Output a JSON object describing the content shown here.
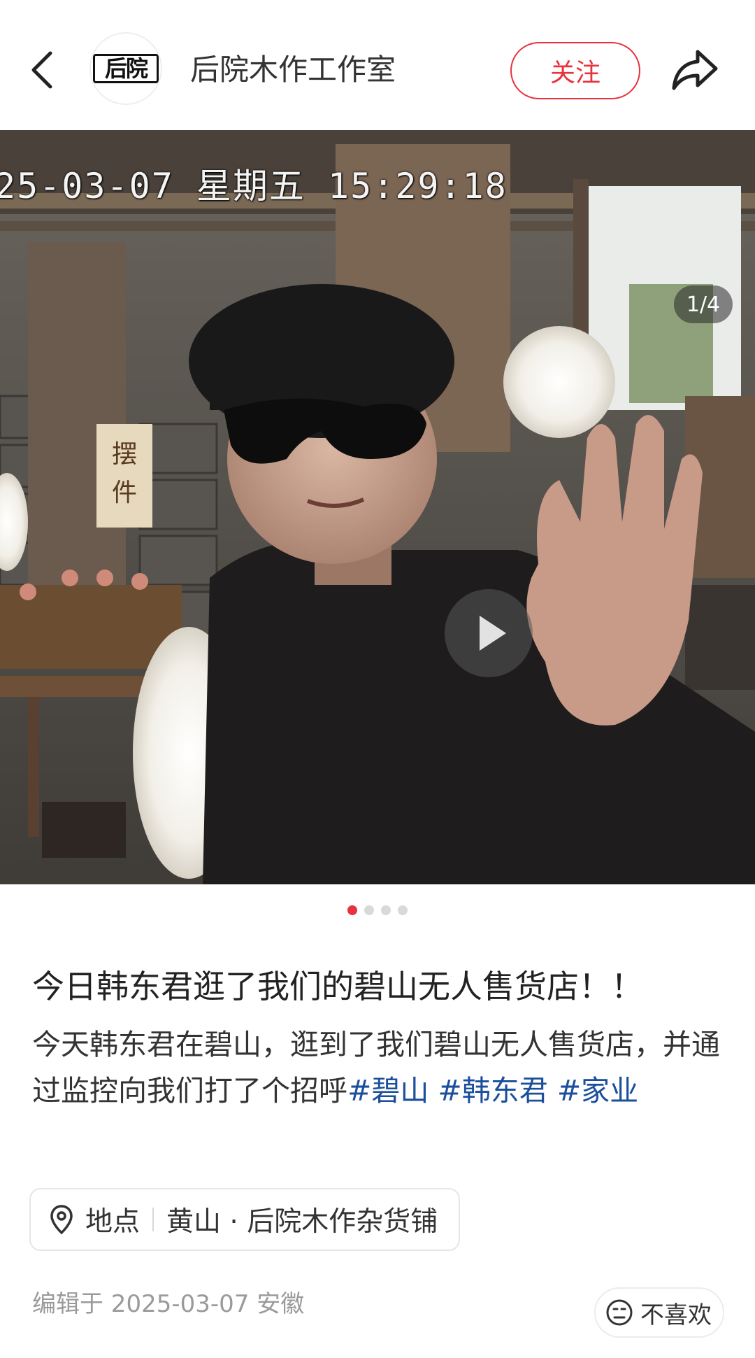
{
  "header": {
    "avatar_logo": "后院",
    "author_name": "后院木作工作室",
    "follow_label": "关注"
  },
  "media": {
    "timestamp_overlay": "25-03-07 星期五 15:29:18",
    "counter": "1/4",
    "current_index": 1,
    "total": 4
  },
  "post": {
    "title": "今日韩东君逛了我们的碧山无人售货店！！",
    "body_text": "今天韩东君在碧山，逛到了我们碧山无人售货店，并通过监控向我们打了个招呼",
    "tags": [
      "#碧山",
      "#韩东君",
      "#家业"
    ]
  },
  "location": {
    "label": "地点",
    "place": "黄山 · 后院木作杂货铺"
  },
  "footer": {
    "edited_text": "编辑于 2025-03-07 安徽",
    "dislike_label": "不喜欢"
  },
  "colors": {
    "accent": "#e8323e",
    "tag": "#1b4f9c"
  },
  "icons": [
    "back-arrow-icon",
    "share-icon",
    "play-icon",
    "location-pin-icon",
    "neutral-face-icon"
  ]
}
